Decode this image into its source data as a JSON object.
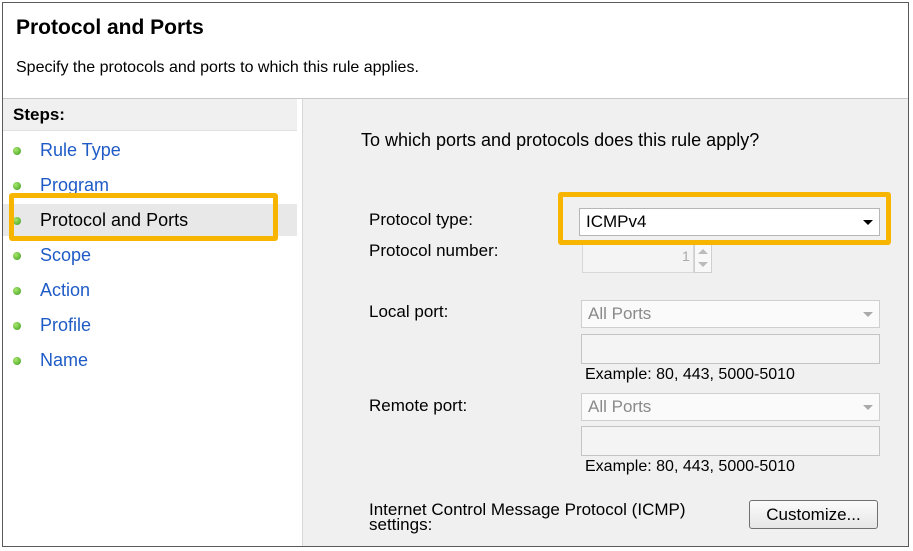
{
  "header": {
    "title": "Protocol and Ports",
    "subtitle": "Specify the protocols and ports to which this rule applies."
  },
  "sidebar": {
    "steps_title": "Steps:",
    "items": [
      {
        "label": "Rule Type"
      },
      {
        "label": "Program"
      },
      {
        "label": "Protocol and Ports",
        "active": true
      },
      {
        "label": "Scope"
      },
      {
        "label": "Action"
      },
      {
        "label": "Profile"
      },
      {
        "label": "Name"
      }
    ]
  },
  "main": {
    "question": "To which ports and protocols does this rule apply?",
    "protocol_type_label": "Protocol type:",
    "protocol_type_value": "ICMPv4",
    "protocol_number_label": "Protocol number:",
    "protocol_number_value": "1",
    "local_port_label": "Local port:",
    "local_port_value": "All Ports",
    "local_example": "Example: 80, 443, 5000-5010",
    "remote_port_label": "Remote port:",
    "remote_port_value": "All Ports",
    "remote_example": "Example: 80, 443, 5000-5010",
    "icmp_label": "Internet Control Message Protocol (ICMP) settings:",
    "customize_label": "Customize..."
  },
  "colors": {
    "highlight": "#f7b500",
    "link": "#1e5bc6",
    "panel": "#f0f0f0"
  }
}
